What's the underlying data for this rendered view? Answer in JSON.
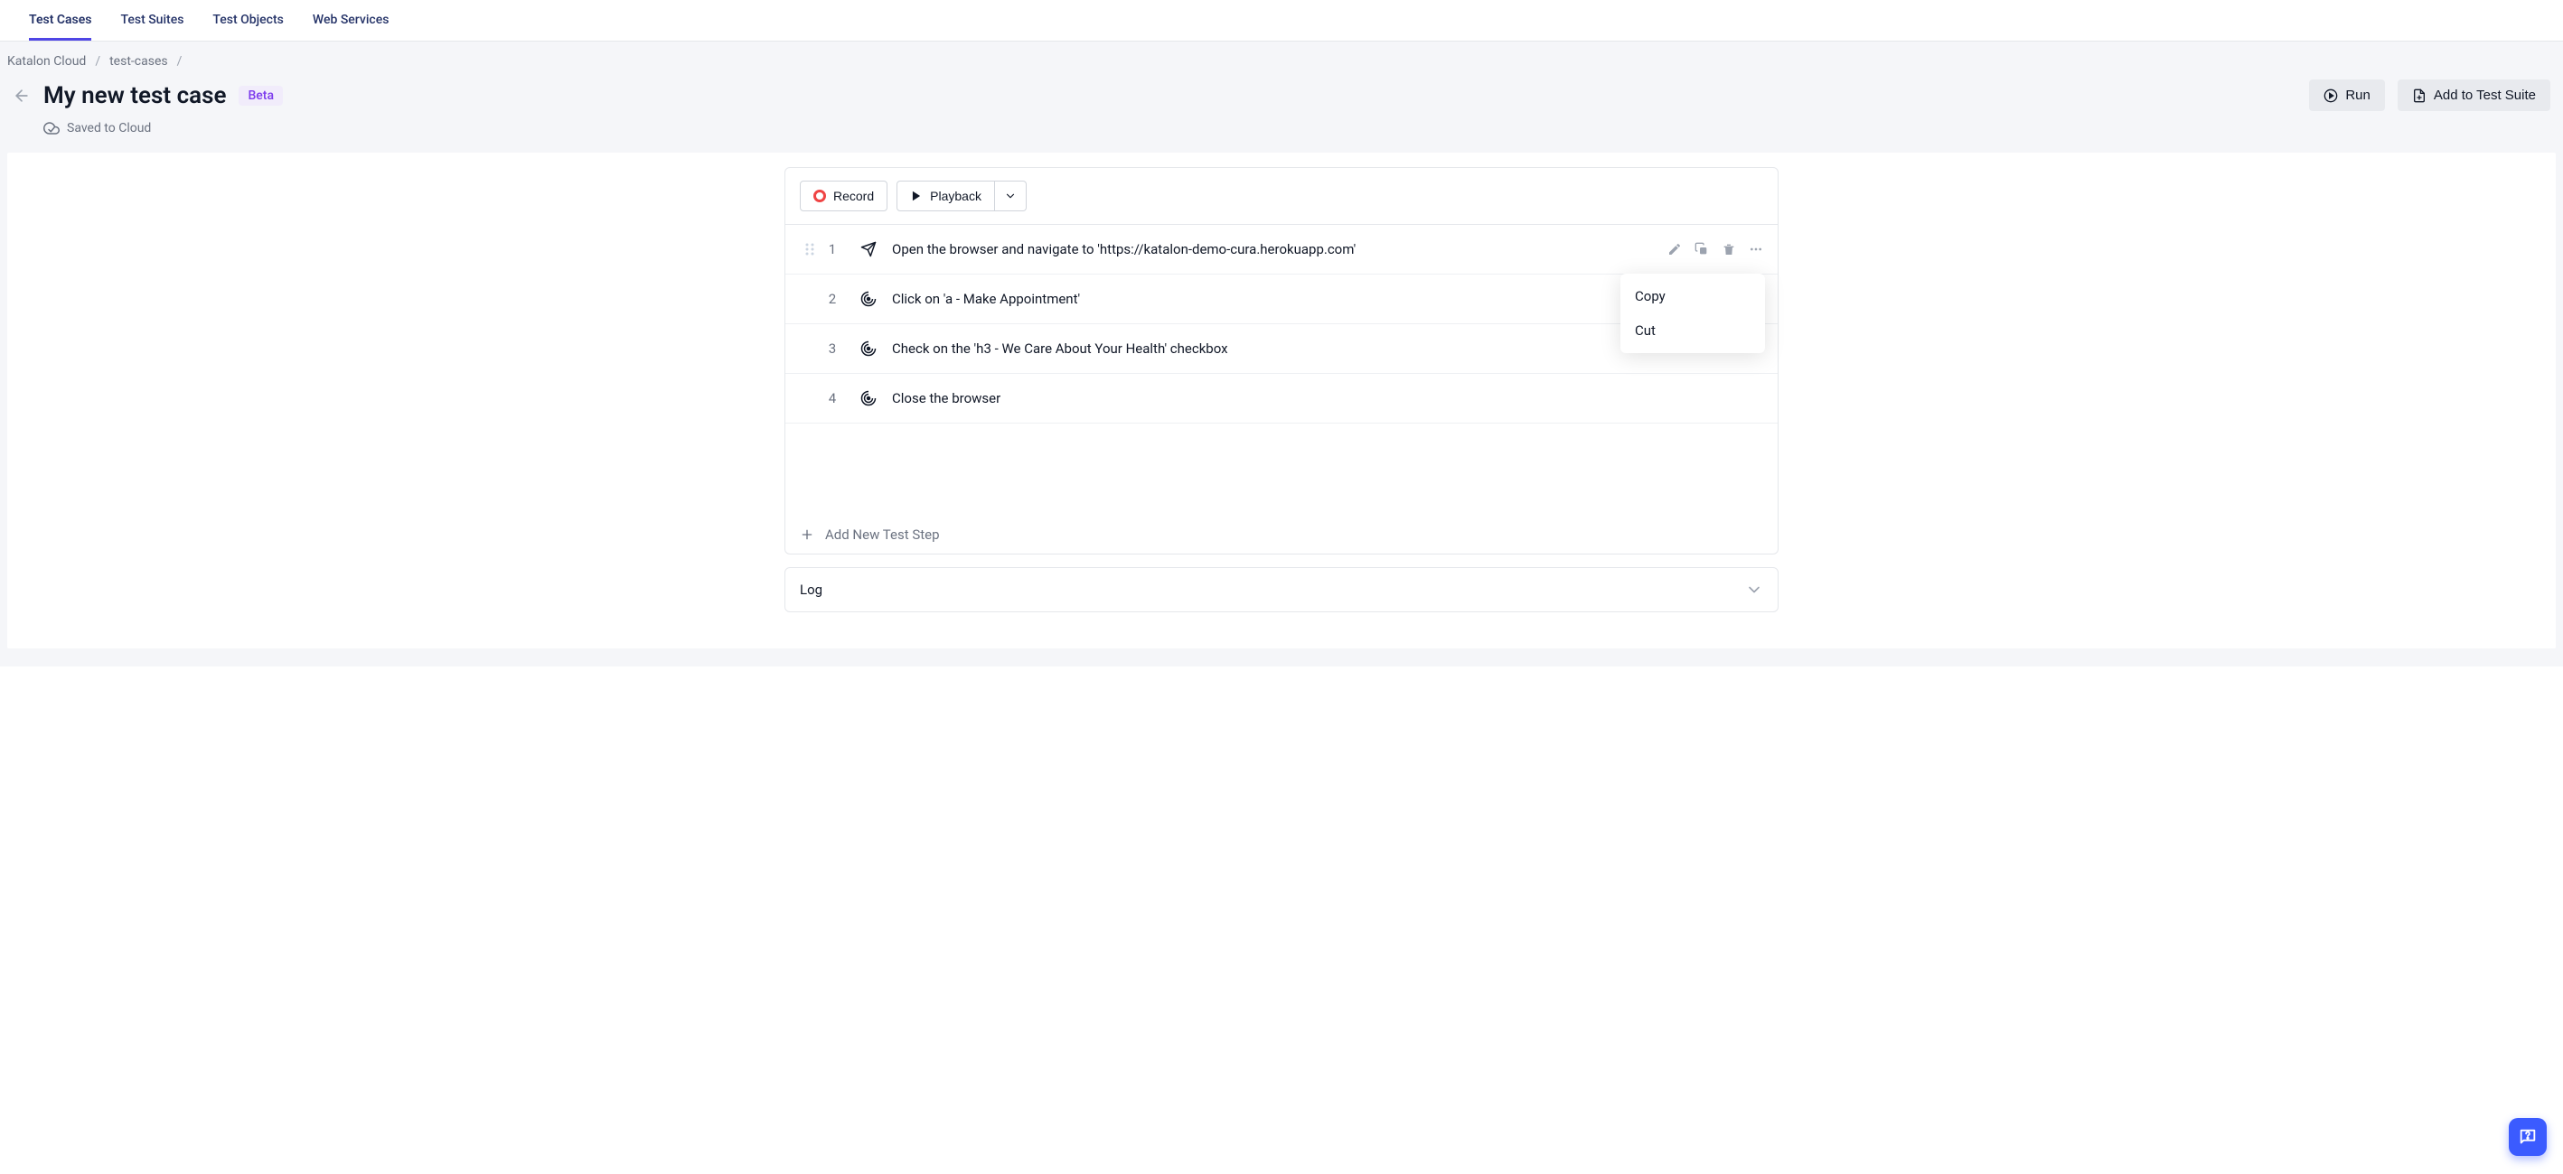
{
  "tabs": [
    {
      "label": "Test Cases",
      "active": true
    },
    {
      "label": "Test Suites",
      "active": false
    },
    {
      "label": "Test Objects",
      "active": false
    },
    {
      "label": "Web Services",
      "active": false
    }
  ],
  "breadcrumb": {
    "items": [
      "Katalon Cloud",
      "test-cases"
    ]
  },
  "header": {
    "title": "My new test case",
    "badge": "Beta",
    "saved_status": "Saved to Cloud",
    "run_label": "Run",
    "add_to_suite_label": "Add to Test Suite"
  },
  "toolbar": {
    "record_label": "Record",
    "playback_label": "Playback"
  },
  "steps": [
    {
      "index": "1",
      "icon": "navigate",
      "description": "Open the browser and navigate to 'https://katalon-demo-cura.herokuapp.com'"
    },
    {
      "index": "2",
      "icon": "target",
      "description": "Click on 'a - Make Appointment'"
    },
    {
      "index": "3",
      "icon": "target",
      "description": "Check on the 'h3 - We Care About Your Health' checkbox"
    },
    {
      "index": "4",
      "icon": "target",
      "description": "Close the browser"
    }
  ],
  "context_menu": {
    "items": [
      "Copy",
      "Cut"
    ]
  },
  "add_step_label": "Add New Test Step",
  "log_panel_label": "Log"
}
